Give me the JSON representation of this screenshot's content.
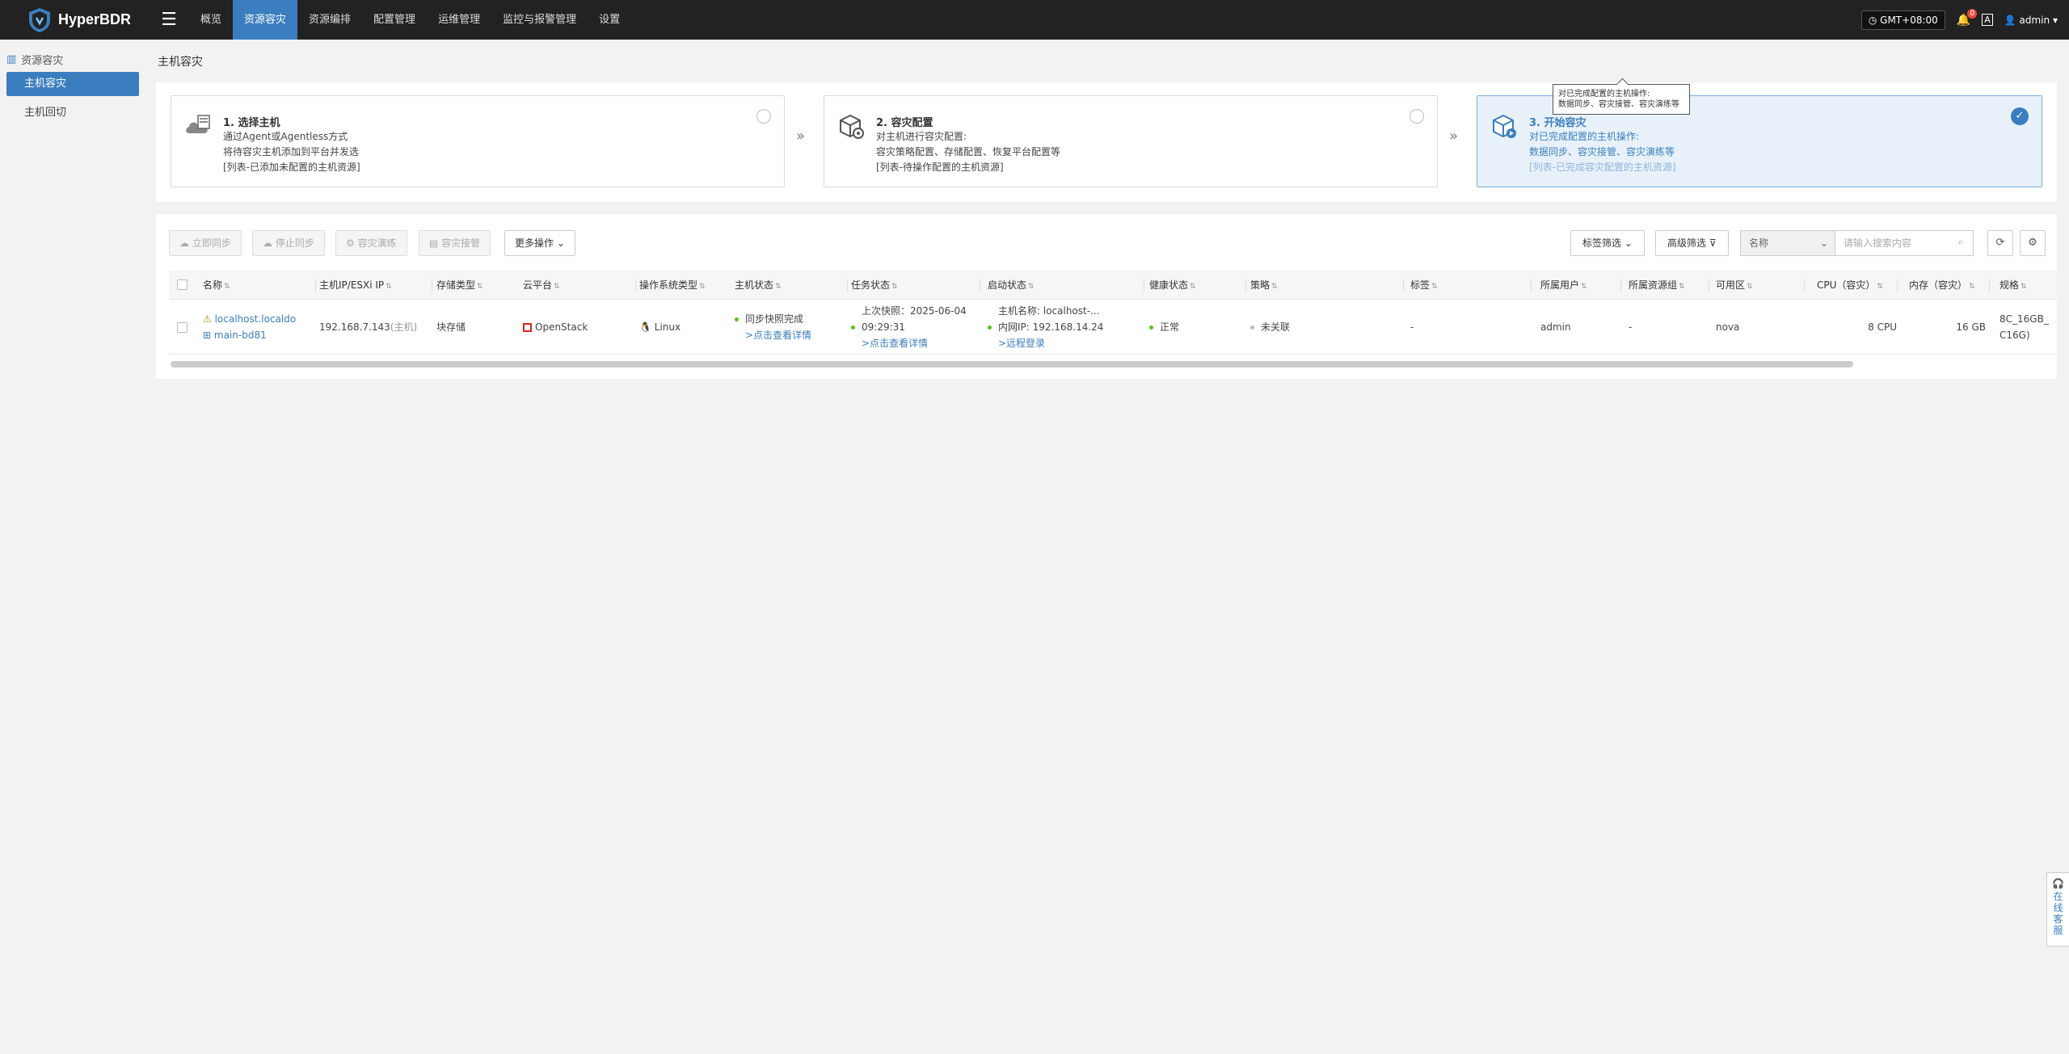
{
  "app": {
    "brand": "HyperBDR"
  },
  "nav": [
    {
      "label": "概览",
      "active": false
    },
    {
      "label": "资源容灾",
      "active": true
    },
    {
      "label": "资源编排",
      "active": false
    },
    {
      "label": "配置管理",
      "active": false
    },
    {
      "label": "运维管理",
      "active": false
    },
    {
      "label": "监控与报警管理",
      "active": false
    },
    {
      "label": "设置",
      "active": false
    }
  ],
  "header": {
    "timezone": "GMT+08:00",
    "alert_count": "0",
    "user": "admin"
  },
  "sidebar": {
    "group": "资源容灾",
    "items": [
      {
        "label": "主机容灾",
        "active": true
      },
      {
        "label": "主机回切",
        "active": false
      }
    ]
  },
  "page": {
    "title": "主机容灾"
  },
  "steps": [
    {
      "title": "1. 选择主机",
      "lines": [
        "通过Agent或Agentless方式",
        "将待容灾主机添加到平台并发选",
        "[列表-已添加未配置的主机资源]"
      ]
    },
    {
      "title": "2. 容灾配置",
      "lines": [
        "对主机进行容灾配置:",
        "容灾策略配置、存储配置、恢复平台配置等",
        "[列表-待操作配置的主机资源]"
      ]
    },
    {
      "title": "3. 开始容灾",
      "lines": [
        "对已完成配置的主机操作:",
        "数据同步、容灾接管、容灾演练等",
        "[列表-已完成容灾配置的主机资源]"
      ]
    }
  ],
  "tooltip": {
    "line1": "对已完成配置的主机操作:",
    "line2": "数据同步、容灾接管、容灾演练等"
  },
  "toolbar": {
    "sync_now": "立即同步",
    "stop_sync": "停止同步",
    "drill": "容灾演练",
    "takeover": "容灾接管",
    "more": "更多操作",
    "tag_filter": "标签筛选",
    "advanced_filter": "高级筛选",
    "search_field": "名称",
    "search_placeholder": "请输入搜索内容"
  },
  "table": {
    "columns": [
      "名称",
      "主机IP/ESXi IP",
      "存储类型",
      "云平台",
      "操作系统类型",
      "主机状态",
      "任务状态",
      "启动状态",
      "健康状态",
      "策略",
      "标签",
      "所属用户",
      "所属资源组",
      "可用区",
      "CPU（容灾）",
      "内存（容灾）",
      "规格"
    ],
    "row": {
      "name_line1": "localhost.localdo",
      "name_line2": "main-bd81",
      "ip": "192.168.7.143",
      "ip_suffix": "(主机)",
      "storage": "块存储",
      "cloud": "OpenStack",
      "os": "Linux",
      "host_status": "同步快照完成",
      "host_status_link": ">点击查看详情",
      "task_line1": "上次快照：2025-06-04",
      "task_line2": "09:29:31",
      "task_link": ">点击查看详情",
      "boot_line1": "主机名称: localhost-...",
      "boot_line2": "内网IP: 192.168.14.24",
      "boot_link": ">远程登录",
      "health": "正常",
      "policy": "未关联",
      "tag": "-",
      "owner": "admin",
      "resource_group": "-",
      "zone": "nova",
      "cpu": "8 CPU",
      "memory": "16 GB",
      "spec_line1": "8C_16GB_",
      "spec_line2": "C16G)"
    }
  },
  "service": {
    "label": "在线客服"
  }
}
